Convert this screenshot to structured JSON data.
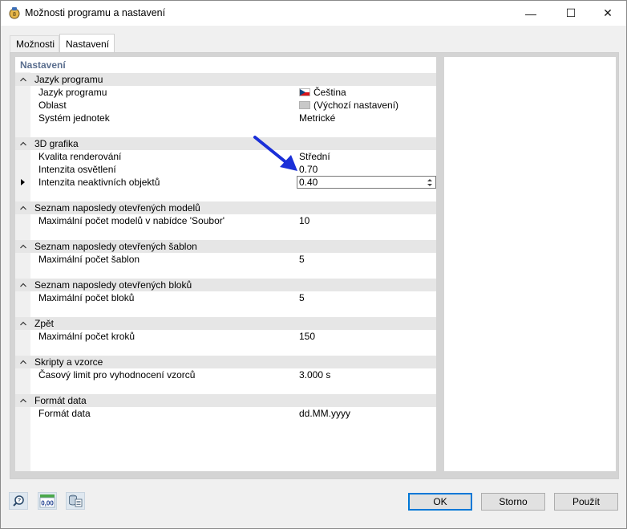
{
  "window": {
    "title": "Možnosti programu a nastavení",
    "controls": {
      "minimize": "—",
      "maximize": "☐",
      "close": "✕"
    }
  },
  "tabs": [
    {
      "label": "Možnosti",
      "active": false
    },
    {
      "label": "Nastavení",
      "active": true
    }
  ],
  "panel": {
    "title": "Nastavení",
    "groups": [
      {
        "label": "Jazyk programu",
        "items": [
          {
            "label": "Jazyk programu",
            "value": "Čeština",
            "icon": "czech-flag-icon"
          },
          {
            "label": "Oblast",
            "value": "(Výchozí nastavení)",
            "icon": "gray-swatch-icon"
          },
          {
            "label": "Systém jednotek",
            "value": "Metrické"
          }
        ]
      },
      {
        "label": "3D grafika",
        "items": [
          {
            "label": "Kvalita renderování",
            "value": "Střední"
          },
          {
            "label": "Intenzita osvětlení",
            "value": "0.70"
          },
          {
            "label": "Intenzita neaktivních objektů",
            "value": "0.40",
            "editing": true
          }
        ]
      },
      {
        "label": "Seznam naposledy otevřených modelů",
        "items": [
          {
            "label": "Maximální počet modelů v nabídce 'Soubor'",
            "value": "10"
          }
        ]
      },
      {
        "label": "Seznam naposledy otevřených šablon",
        "items": [
          {
            "label": "Maximální počet šablon",
            "value": "5"
          }
        ]
      },
      {
        "label": "Seznam naposledy otevřených bloků",
        "items": [
          {
            "label": "Maximální počet bloků",
            "value": "5"
          }
        ]
      },
      {
        "label": "Zpět",
        "items": [
          {
            "label": "Maximální počet kroků",
            "value": "150"
          }
        ]
      },
      {
        "label": "Skripty a vzorce",
        "items": [
          {
            "label": "Časový limit pro vyhodnocení vzorců",
            "value": "3.000 s"
          }
        ]
      },
      {
        "label": "Formát data",
        "items": [
          {
            "label": "Formát data",
            "value": "dd.MM.yyyy"
          }
        ]
      }
    ]
  },
  "toolbar": {
    "units_icon_text": "0,00"
  },
  "buttons": {
    "ok": "OK",
    "cancel": "Storno",
    "apply": "Použít"
  },
  "colors": {
    "accent": "#0078d7",
    "annotation_arrow": "#1a2fd8",
    "group_header": "#e6e6e6",
    "section_title": "#5a6e8e"
  }
}
